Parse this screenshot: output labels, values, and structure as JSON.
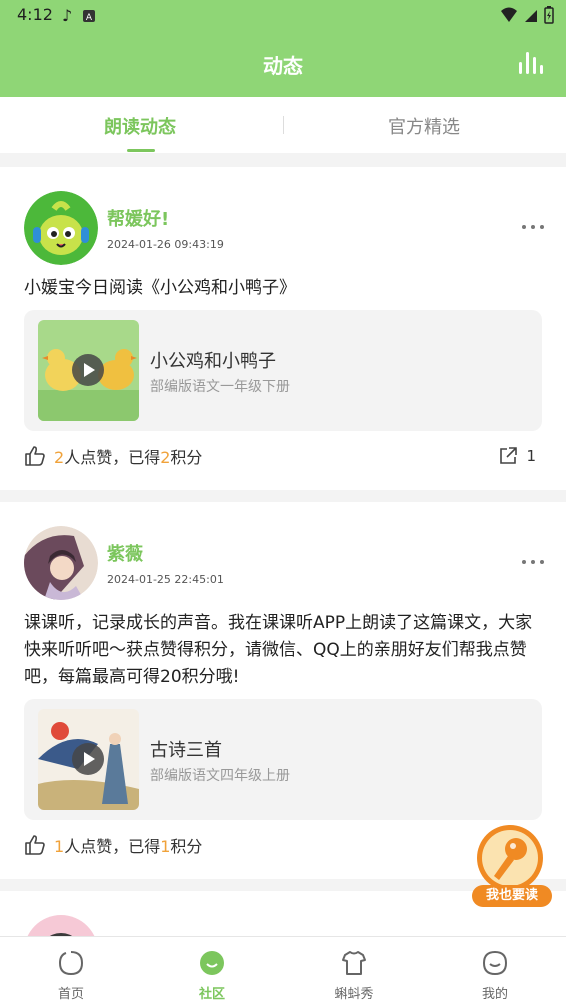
{
  "status_bar": {
    "time": "4:12"
  },
  "app_bar": {
    "title": "动态"
  },
  "tabs": [
    {
      "label": "朗读动态",
      "active": true
    },
    {
      "label": "官方精选",
      "active": false
    }
  ],
  "posts": [
    {
      "username": "帮媛好!",
      "timestamp": "2024-01-26 09:43:19",
      "text": "小媛宝今日阅读《小公鸡和小鸭子》",
      "lesson": {
        "title": "小公鸡和小鸭子",
        "subtitle": "部编版语文一年级下册"
      },
      "likes": {
        "count": "2",
        "text_mid": "人点赞，已得",
        "points": "2",
        "text_end": "积分"
      },
      "shares": "1"
    },
    {
      "username": "紫薇",
      "timestamp": "2024-01-25 22:45:01",
      "text": "课课听，记录成长的声音。我在课课听APP上朗读了这篇课文，大家快来听听吧～获点赞得积分，请微信、QQ上的亲朋好友们帮我点赞吧，每篇最高可得20积分哦!",
      "lesson": {
        "title": "古诗三首",
        "subtitle": "部编版语文四年级上册"
      },
      "likes": {
        "count": "1",
        "text_mid": "人点赞，已得",
        "points": "1",
        "text_end": "积分"
      }
    }
  ],
  "fab": {
    "label": "我也要读"
  },
  "bottom_nav": [
    {
      "label": "首页",
      "icon": "home-icon",
      "active": false
    },
    {
      "label": "社区",
      "icon": "community-icon",
      "active": true
    },
    {
      "label": "蝌蚪秀",
      "icon": "tadpole-show-icon",
      "active": false
    },
    {
      "label": "我的",
      "icon": "profile-icon",
      "active": false
    }
  ],
  "colors": {
    "primary": "#8fd676",
    "accent_green": "#7cc65d",
    "accent_orange": "#f0a23a"
  }
}
